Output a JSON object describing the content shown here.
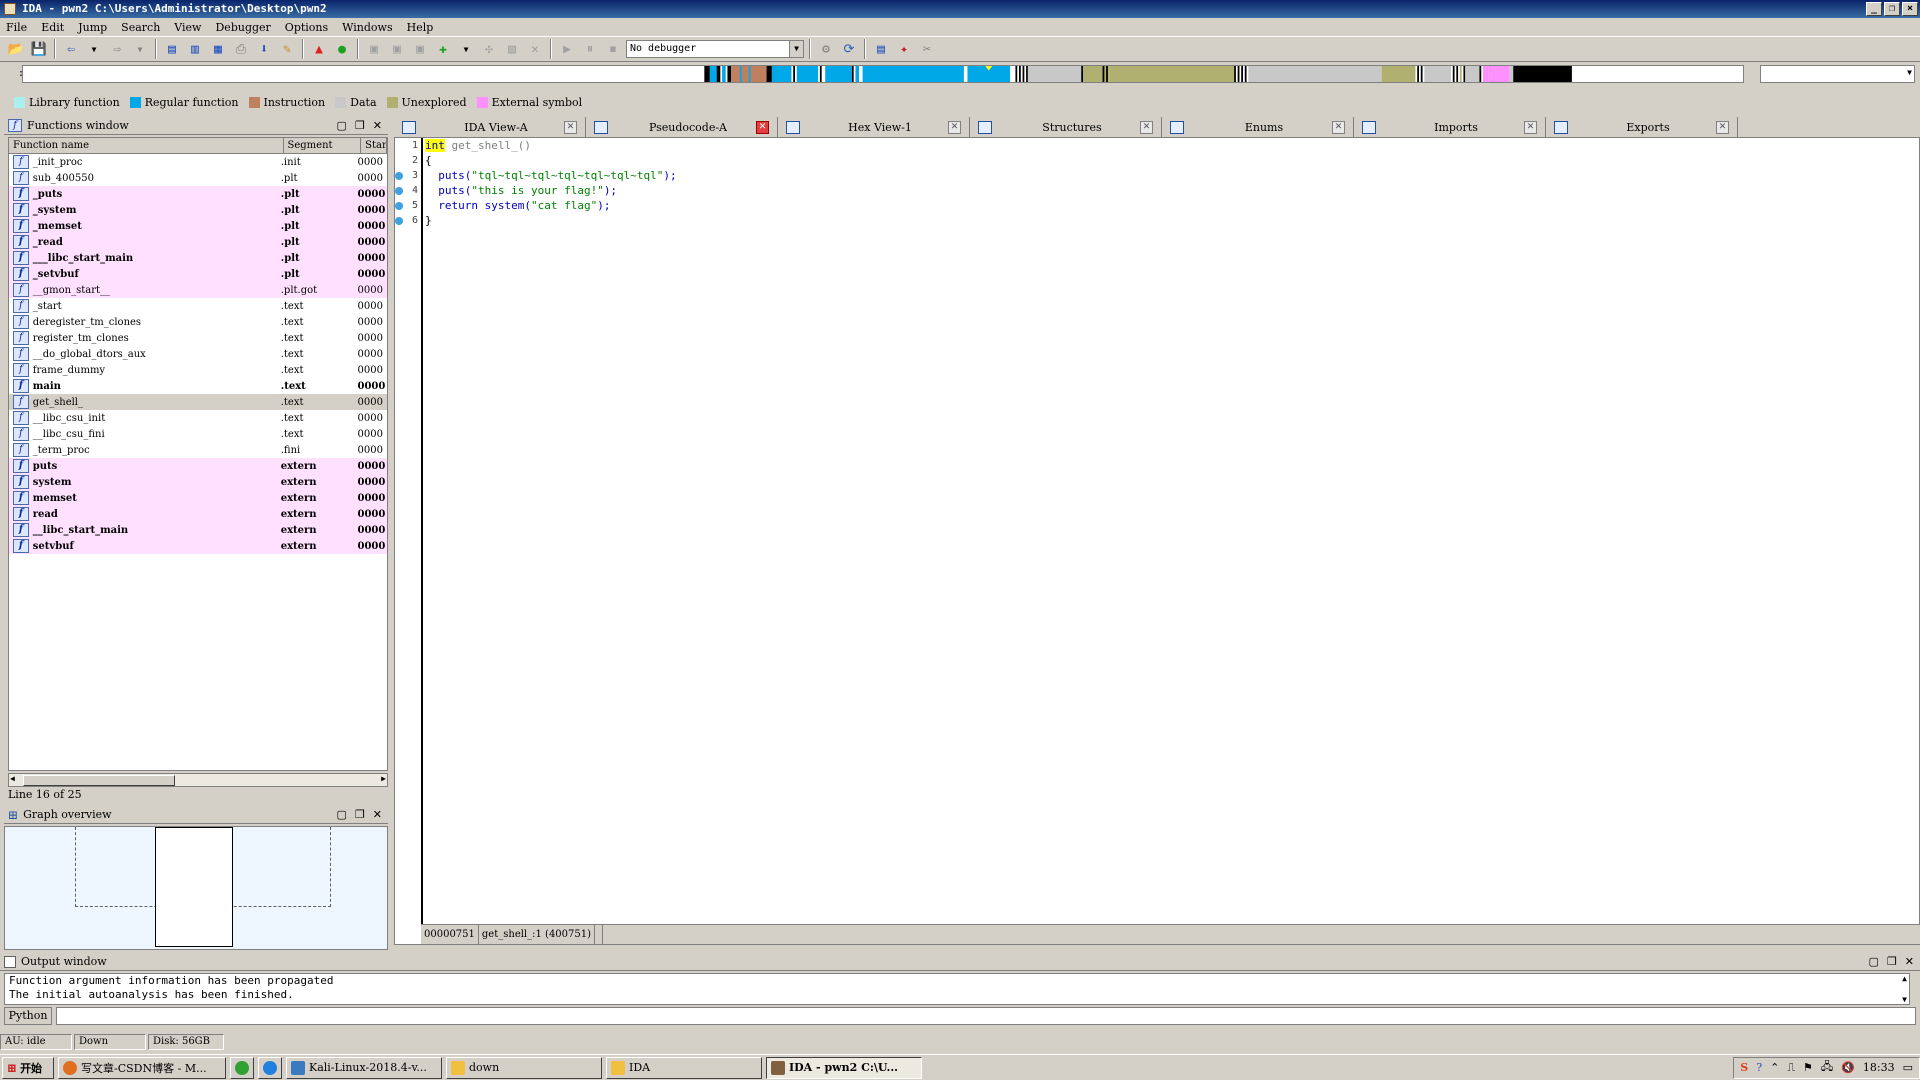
{
  "window": {
    "title": "IDA - pwn2 C:\\Users\\Administrator\\Desktop\\pwn2"
  },
  "menu": [
    "File",
    "Edit",
    "Jump",
    "Search",
    "View",
    "Debugger",
    "Options",
    "Windows",
    "Help"
  ],
  "toolbar": {
    "debugger_select": "No debugger"
  },
  "legend": [
    {
      "label": "Library function",
      "color": "#aaf0f0"
    },
    {
      "label": "Regular function",
      "color": "#00a8e8"
    },
    {
      "label": "Instruction",
      "color": "#c08060"
    },
    {
      "label": "Data",
      "color": "#c8c8c8"
    },
    {
      "label": "Unexplored",
      "color": "#b0b070"
    },
    {
      "label": "External symbol",
      "color": "#ff90ff"
    }
  ],
  "functions": {
    "title": "Functions window",
    "columns": [
      "Function name",
      "Segment",
      "Start"
    ],
    "rows": [
      {
        "name": "_init_proc",
        "seg": ".init",
        "start": "0000",
        "style": "normal"
      },
      {
        "name": "sub_400550",
        "seg": ".plt",
        "start": "0000",
        "style": "normal"
      },
      {
        "name": "_puts",
        "seg": ".plt",
        "start": "0000",
        "style": "pink"
      },
      {
        "name": "_system",
        "seg": ".plt",
        "start": "0000",
        "style": "pink"
      },
      {
        "name": "_memset",
        "seg": ".plt",
        "start": "0000",
        "style": "pink"
      },
      {
        "name": "_read",
        "seg": ".plt",
        "start": "0000",
        "style": "pink"
      },
      {
        "name": "___libc_start_main",
        "seg": ".plt",
        "start": "0000",
        "style": "pink"
      },
      {
        "name": "_setvbuf",
        "seg": ".plt",
        "start": "0000",
        "style": "pink"
      },
      {
        "name": "__gmon_start__",
        "seg": ".plt.got",
        "start": "0000",
        "style": "pink-light"
      },
      {
        "name": "_start",
        "seg": ".text",
        "start": "0000",
        "style": "normal"
      },
      {
        "name": "deregister_tm_clones",
        "seg": ".text",
        "start": "0000",
        "style": "normal"
      },
      {
        "name": "register_tm_clones",
        "seg": ".text",
        "start": "0000",
        "style": "normal"
      },
      {
        "name": "__do_global_dtors_aux",
        "seg": ".text",
        "start": "0000",
        "style": "normal"
      },
      {
        "name": "frame_dummy",
        "seg": ".text",
        "start": "0000",
        "style": "normal"
      },
      {
        "name": "main",
        "seg": ".text",
        "start": "0000",
        "style": "bold"
      },
      {
        "name": "get_shell_",
        "seg": ".text",
        "start": "0000",
        "style": "sel"
      },
      {
        "name": "__libc_csu_init",
        "seg": ".text",
        "start": "0000",
        "style": "normal"
      },
      {
        "name": "__libc_csu_fini",
        "seg": ".text",
        "start": "0000",
        "style": "normal"
      },
      {
        "name": "_term_proc",
        "seg": ".fini",
        "start": "0000",
        "style": "normal"
      },
      {
        "name": "puts",
        "seg": "extern",
        "start": "0000",
        "style": "pink"
      },
      {
        "name": "system",
        "seg": "extern",
        "start": "0000",
        "style": "pink"
      },
      {
        "name": "memset",
        "seg": "extern",
        "start": "0000",
        "style": "pink"
      },
      {
        "name": "read",
        "seg": "extern",
        "start": "0000",
        "style": "pink"
      },
      {
        "name": "__libc_start_main",
        "seg": "extern",
        "start": "0000",
        "style": "pink"
      },
      {
        "name": "setvbuf",
        "seg": "extern",
        "start": "0000",
        "style": "pink"
      }
    ],
    "line_info": "Line 16 of 25"
  },
  "graph": {
    "title": "Graph overview"
  },
  "tabs": [
    {
      "label": "IDA View-A",
      "active": false
    },
    {
      "label": "Pseudocode-A",
      "active": true
    },
    {
      "label": "Hex View-1",
      "active": false
    },
    {
      "label": "Structures",
      "active": false
    },
    {
      "label": "Enums",
      "active": false
    },
    {
      "label": "Imports",
      "active": false
    },
    {
      "label": "Exports",
      "active": false
    }
  ],
  "code": {
    "lines": [
      {
        "n": "1",
        "dot": false,
        "parts": [
          [
            "hl kw",
            "int"
          ],
          [
            "fnname",
            " get_shell_()"
          ]
        ]
      },
      {
        "n": "2",
        "dot": false,
        "parts": [
          [
            "",
            "{"
          ]
        ]
      },
      {
        "n": "3",
        "dot": true,
        "parts": [
          [
            "kw",
            "  puts("
          ],
          [
            "str",
            "\"tql~tql~tql~tql~tql~tql~tql\""
          ],
          [
            "kw",
            ");"
          ]
        ]
      },
      {
        "n": "4",
        "dot": true,
        "parts": [
          [
            "kw",
            "  puts("
          ],
          [
            "str",
            "\"this is your flag!\""
          ],
          [
            "kw",
            ");"
          ]
        ]
      },
      {
        "n": "5",
        "dot": true,
        "parts": [
          [
            "kw",
            "  return system("
          ],
          [
            "str",
            "\"cat flag\""
          ],
          [
            "kw",
            ");"
          ]
        ]
      },
      {
        "n": "6",
        "dot": true,
        "parts": [
          [
            "",
            "}"
          ]
        ]
      }
    ],
    "status": [
      "00000751",
      "get_shell_:1 (400751)",
      ""
    ]
  },
  "output": {
    "title": "Output window",
    "lines": [
      "Function argument information has been propagated",
      "The initial autoanalysis has been finished."
    ],
    "python_label": "Python"
  },
  "status": {
    "au": "AU:  idle",
    "dir": "Down",
    "disk": "Disk: 56GB"
  },
  "taskbar": {
    "start": "开始",
    "tasks": [
      "写文章-CSDN博客 - M...",
      "Kali-Linux-2018.4-v...",
      "down",
      "IDA",
      "IDA - pwn2 C:\\U..."
    ],
    "clock": "18:33"
  }
}
